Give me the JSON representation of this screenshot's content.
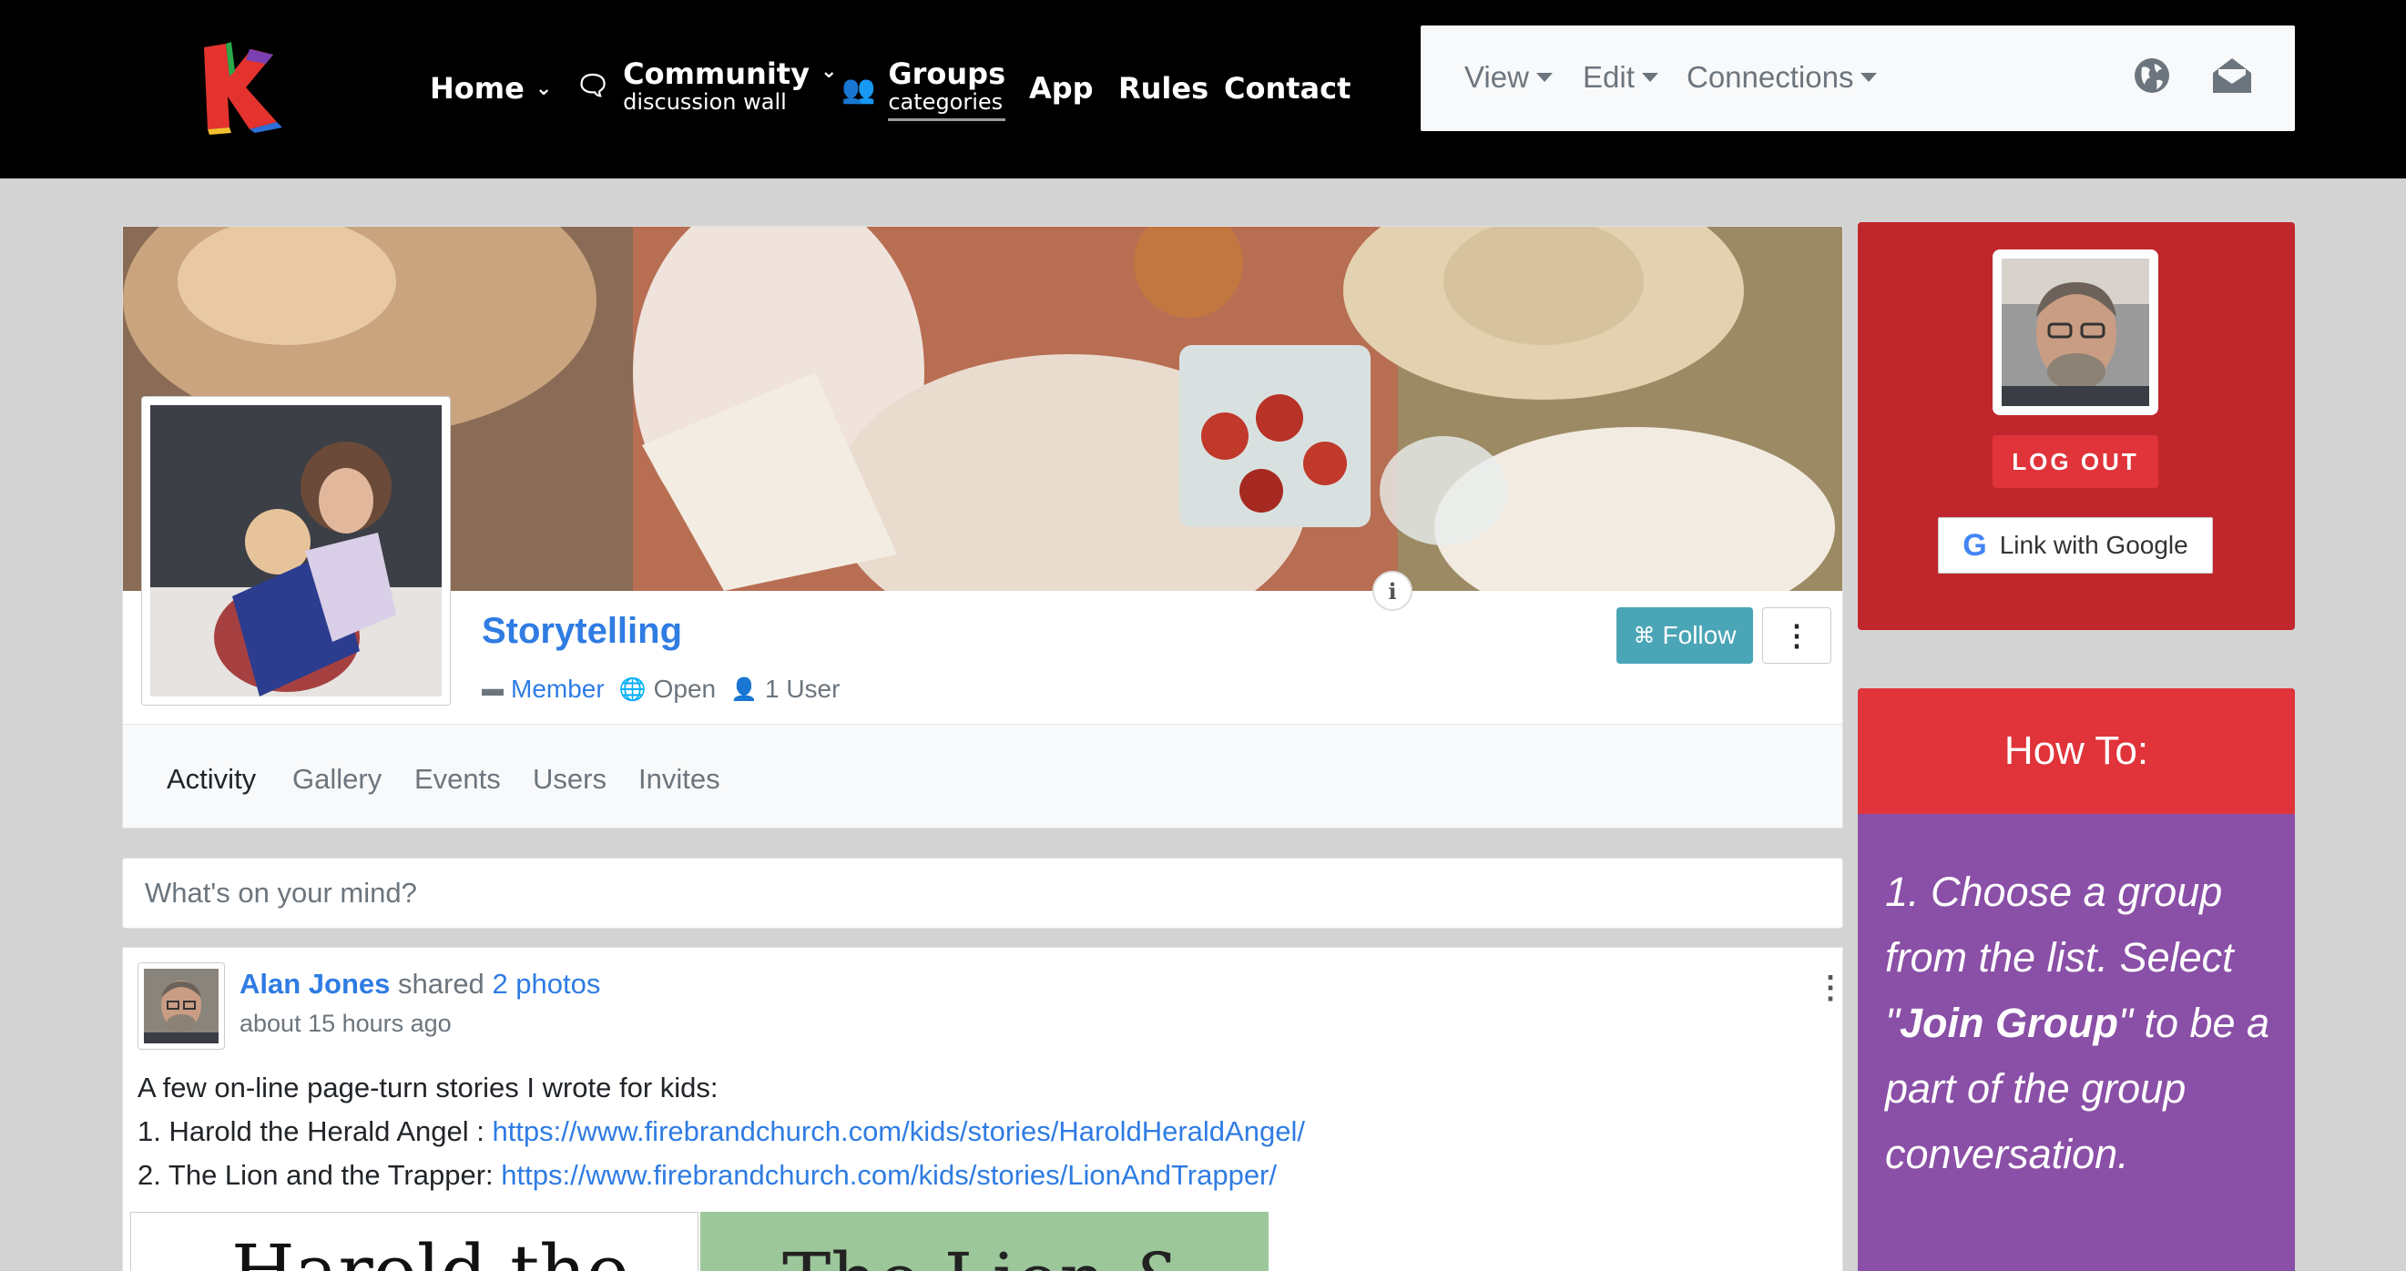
{
  "nav": {
    "logo_letter": "K",
    "home": "Home",
    "community": "Community",
    "community_sub": "discussion wall",
    "groups": "Groups",
    "groups_sub": "categories",
    "app": "App",
    "rules": "Rules",
    "contact": "Contact"
  },
  "user_menu": {
    "view": "View",
    "edit": "Edit",
    "connections": "Connections",
    "icons": [
      "globe-icon",
      "envelope-open-icon"
    ]
  },
  "group": {
    "title": "Storytelling",
    "category": "Member",
    "privacy": "Open",
    "members": "1 User",
    "follow_label": "Follow",
    "more_label": "⋮",
    "info_label": "i",
    "tabs": [
      "Activity",
      "Gallery",
      "Events",
      "Users",
      "Invites"
    ],
    "active_tab": "Activity"
  },
  "composer": {
    "placeholder": "What's on your mind?"
  },
  "post": {
    "author": "Alan Jones",
    "action": "shared",
    "object": "2 photos",
    "time": "about 15 hours ago",
    "intro": "A few on-line page-turn stories I wrote for kids:",
    "line1_prefix": "1. Harold the Herald Angel : ",
    "line1_link": "https://www.firebrandchurch.com/kids/stories/HaroldHeraldAngel/",
    "line2_prefix": "2. The Lion and the Trapper: ",
    "line2_link": "https://www.firebrandchurch.com/kids/stories/LionAndTrapper/",
    "thumb1_text": "Harold the",
    "thumb2_text": "The Lion &"
  },
  "sidebar": {
    "logout": "LOG OUT",
    "google": "Link with Google",
    "howto_title": "How To:",
    "howto_p1": "1. Choose a group from the list. Select \"",
    "howto_bold": "Join Group",
    "howto_p2": "\" to be a part of the group conversation."
  },
  "colors": {
    "accent_blue": "#2f7ce3",
    "follow_teal": "#4aa5b6",
    "login_red": "#c0272d",
    "howto_purple": "#8a4fa6",
    "howto_red": "#e0343a"
  }
}
